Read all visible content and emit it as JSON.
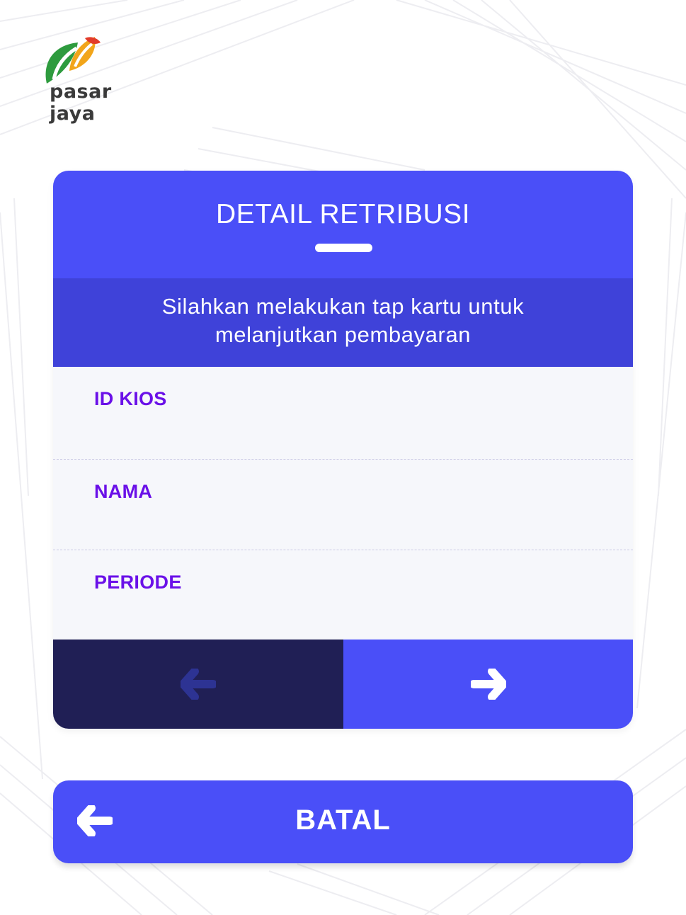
{
  "brand": {
    "name": "pasar jaya"
  },
  "card": {
    "title": "DETAIL RETRIBUSI",
    "instruction_line1": "Silahkan melakukan tap kartu untuk",
    "instruction_line2": "melanjutkan pembayaran",
    "fields": [
      {
        "label": "ID KIOS",
        "value": ""
      },
      {
        "label": "NAMA",
        "value": ""
      },
      {
        "label": "PERIODE",
        "value": ""
      }
    ],
    "nav": {
      "prev_icon": "arrow-left-icon",
      "next_icon": "arrow-right-icon"
    }
  },
  "cancel": {
    "label": "BATAL",
    "icon": "arrow-left-icon"
  },
  "colors": {
    "primary": "#4a4ff8",
    "primary_dark": "#3f42d9",
    "navy": "#201f55",
    "label": "#6a10e8",
    "field_bg": "#f6f7fb"
  }
}
